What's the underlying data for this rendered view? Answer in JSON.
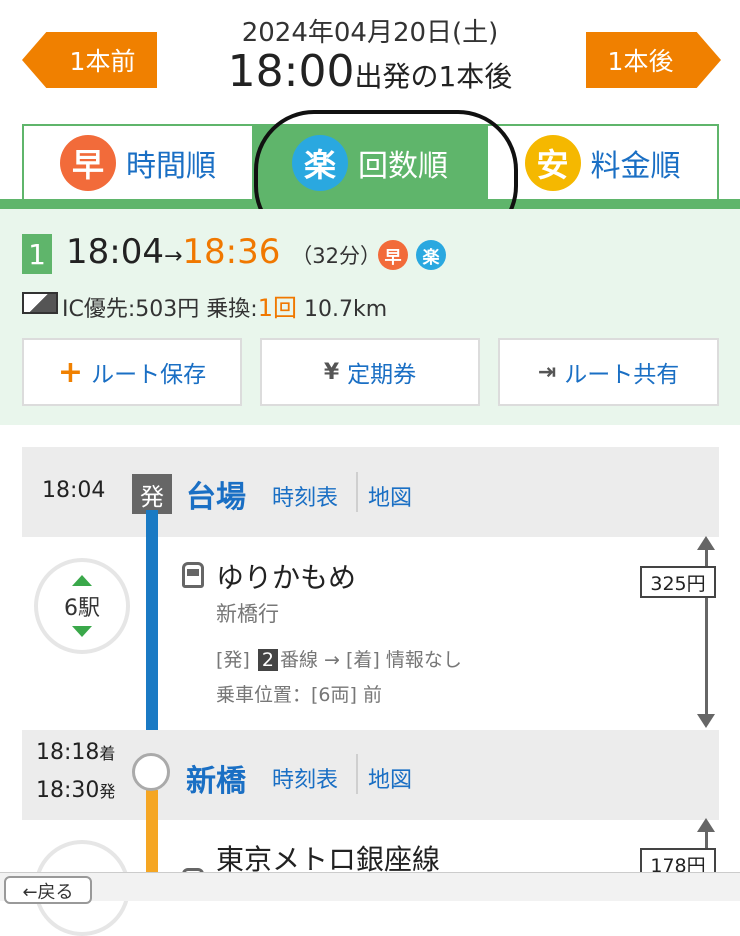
{
  "header": {
    "date": "2024年04月20日(土)",
    "depart_time": "18:00",
    "depart_suffix": "出発の1本後",
    "prev_label": "1本前",
    "next_label": "1本後"
  },
  "tabs": [
    {
      "badge": "早",
      "label": "時間順",
      "color": "#f26b3a",
      "active": false
    },
    {
      "badge": "楽",
      "label": "回数順",
      "color": "#2aa8e0",
      "active": true
    },
    {
      "badge": "安",
      "label": "料金順",
      "color": "#f5b800",
      "active": false
    }
  ],
  "route": {
    "number": "1",
    "depart": "18:04",
    "arrow": "→",
    "arrive": "18:36",
    "duration": "（32分）",
    "badges": [
      "早",
      "楽"
    ],
    "fare_text": "IC優先:503円",
    "transfer_label": "乗換:",
    "transfer_count": "1回",
    "distance": "10.7km"
  },
  "actions": [
    {
      "icon": "+",
      "label": "ルート保存"
    },
    {
      "icon": "¥",
      "label": "定期券"
    },
    {
      "icon": "⇥",
      "label": "ルート共有"
    }
  ],
  "stations": [
    {
      "time": "18:04",
      "marker": "発",
      "name": "台場",
      "timetable": "時刻表",
      "map": "地図"
    },
    {
      "arr_time": "18:18",
      "arr_suffix": "着",
      "dep_time": "18:30",
      "dep_suffix": "発",
      "name": "新橋",
      "timetable": "時刻表",
      "map": "地図"
    }
  ],
  "segments": [
    {
      "stops": "6駅",
      "line": "ゆりかもめ",
      "destination": "新橋行",
      "platform_prefix": "[発]",
      "platform_no": "2",
      "platform_suffix": "番線 → [着] 情報なし",
      "car_position": "乗車位置：[6両] 前",
      "fare": "325円"
    },
    {
      "line": "東京メトロ銀座線",
      "fare": "178円"
    }
  ],
  "bottom": {
    "back_label": "←戻る"
  }
}
